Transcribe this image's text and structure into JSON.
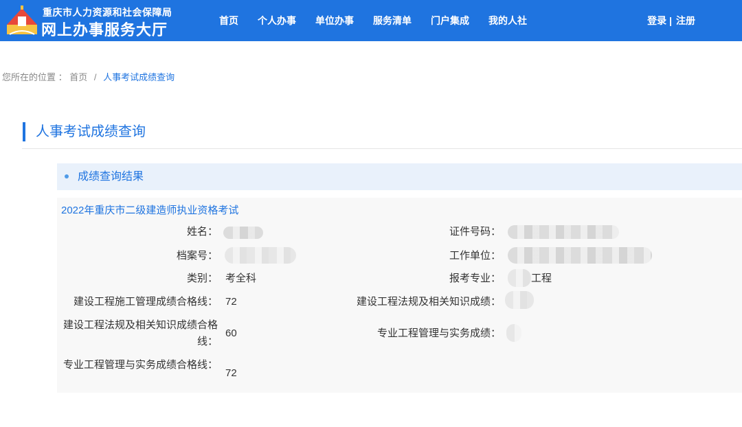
{
  "header": {
    "org_name": "重庆市人力资源和社会保障局",
    "portal_name": "网上办事服务大厅",
    "nav": [
      {
        "label": "首页"
      },
      {
        "label": "个人办事"
      },
      {
        "label": "单位办事"
      },
      {
        "label": "服务清单"
      },
      {
        "label": "门户集成"
      },
      {
        "label": "我的人社"
      }
    ],
    "login_label": "登录",
    "auth_separator": "|",
    "register_label": "注册",
    "colors": {
      "header_bg": "#1f74e0",
      "accent": "#1f74e0"
    }
  },
  "breadcrumb": {
    "prefix": "您所在的位置 ：",
    "home": "首页",
    "separator": "/",
    "current": "人事考试成绩查询"
  },
  "page": {
    "title": "人事考试成绩查询"
  },
  "section": {
    "title": "成绩查询结果"
  },
  "result": {
    "exam_title": "2022年重庆市二级建造师执业资格考试",
    "fields": {
      "name_label": "姓名：",
      "id_label": "证件号码：",
      "file_no_label": "档案号：",
      "employer_label": "工作单位：",
      "category_label": "类别：",
      "category_value": "考全科",
      "major_label": "报考专业：",
      "major_value": "工程",
      "pass1_label": "建设工程施工管理成绩合格线：",
      "pass1_value": "72",
      "score2_label": "建设工程法规及相关知识成绩：",
      "pass2_label": "建设工程法规及相关知识成绩合格线：",
      "pass2_value": "60",
      "score3_label": "专业工程管理与实务成绩：",
      "pass3_label": "专业工程管理与实务成绩合格线：",
      "pass3_value": "72"
    }
  }
}
